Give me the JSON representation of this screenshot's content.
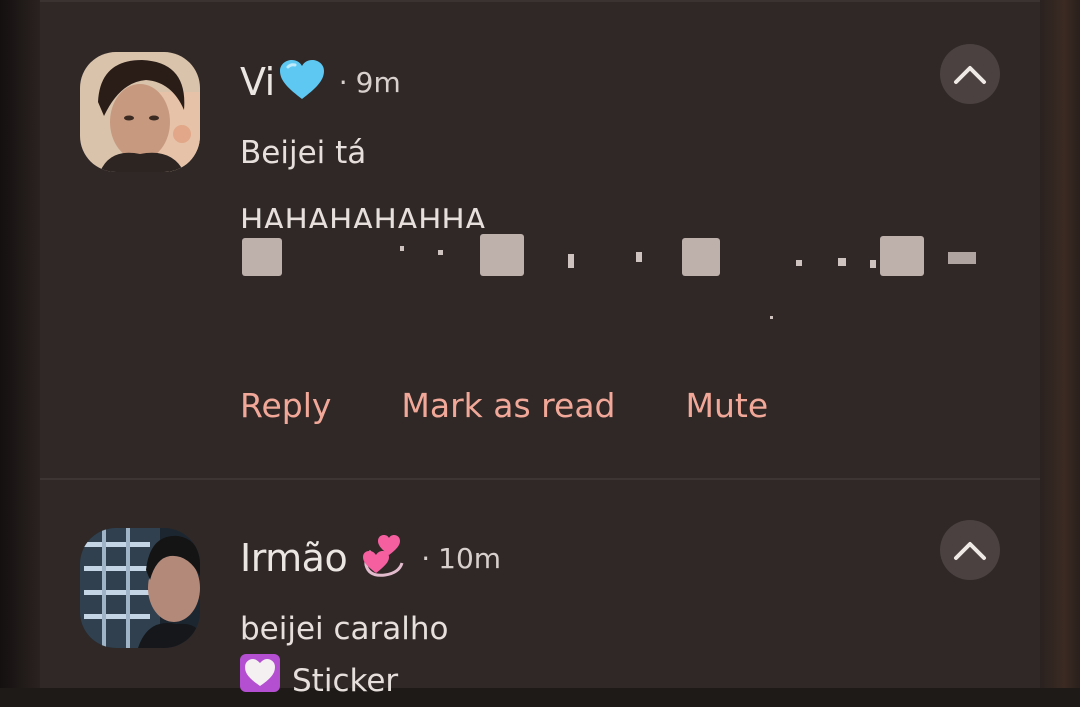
{
  "colors": {
    "background": "#2f2827",
    "text": "#ece6e2",
    "action": "#f2a898",
    "button_bg": "#4a4140",
    "heart_blue": "#5ec8f2",
    "heart_pink": "#f55fa0"
  },
  "notifications": [
    {
      "sender": "Vi",
      "sender_emoji": "blue-heart",
      "time": "9m",
      "separator": "·",
      "lines": [
        "Beijei tá",
        "HAHAHAHAHHA"
      ],
      "redacted_text": true,
      "collapse_icon": "chevron-up-icon",
      "actions": [
        "Reply",
        "Mark as read",
        "Mute"
      ]
    },
    {
      "sender": "Irmão",
      "sender_emoji": "revolving-hearts",
      "time": "10m",
      "separator": "·",
      "lines": [
        "beijei caralho"
      ],
      "sticker_label": "Sticker",
      "sticker_icon": "white-heart-icon",
      "collapse_icon": "chevron-up-icon"
    }
  ]
}
